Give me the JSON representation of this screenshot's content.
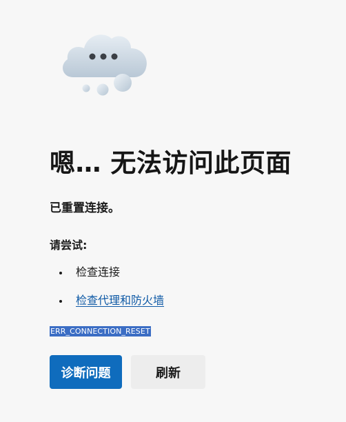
{
  "illustration": {
    "icon": "cloud-with-ellipsis-icon"
  },
  "error_page": {
    "title": "嗯… 无法访问此页面",
    "subtitle": "已重置连接。",
    "try_label": "请尝试:",
    "suggestions": [
      {
        "text": "检查连接",
        "is_link": false
      },
      {
        "text": "检查代理和防火墙",
        "is_link": true
      }
    ],
    "error_code": "ERR_CONNECTION_RESET"
  },
  "actions": {
    "diagnose_label": "诊断问题",
    "refresh_label": "刷新"
  },
  "colors": {
    "background": "#f7f7f7",
    "primary_button": "#0f6cbd",
    "secondary_button": "#ededed",
    "link": "#0f5aa6",
    "error_code_highlight": "#3b6dc4"
  }
}
